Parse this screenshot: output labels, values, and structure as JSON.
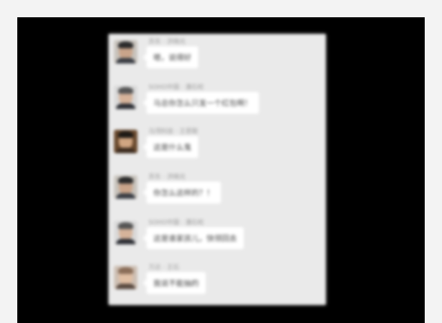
{
  "messages": [
    {
      "sender": "苏东 · 洪晓光",
      "text": "嗯，说得好",
      "avatar_icon": "man-portrait-icon",
      "avatar_color": "#6b7078"
    },
    {
      "sender": "SOHO中国 · 潘石屹",
      "text": "马总你怎么只发一个红包啊！",
      "avatar_icon": "man-portrait-icon",
      "avatar_color": "#8a8f96"
    },
    {
      "sender": "马湾科技 · 王思聪",
      "text": "这是什么鬼",
      "avatar_icon": "man-portrait-icon",
      "avatar_color": "#7a5a3c"
    },
    {
      "sender": "苏东 · 洪晓光",
      "text": "你怎么这样的？！",
      "avatar_icon": "man-portrait-icon",
      "avatar_color": "#6b7078"
    },
    {
      "sender": "SOHO中国 · 潘石屹",
      "text": "这是谁家孩儿，快领回去",
      "avatar_icon": "man-portrait-icon",
      "avatar_color": "#8a8f96"
    },
    {
      "sender": "万达 · 王石",
      "text": "我说不能抽的",
      "avatar_icon": "man-portrait-icon",
      "avatar_color": "#b08a70"
    }
  ]
}
